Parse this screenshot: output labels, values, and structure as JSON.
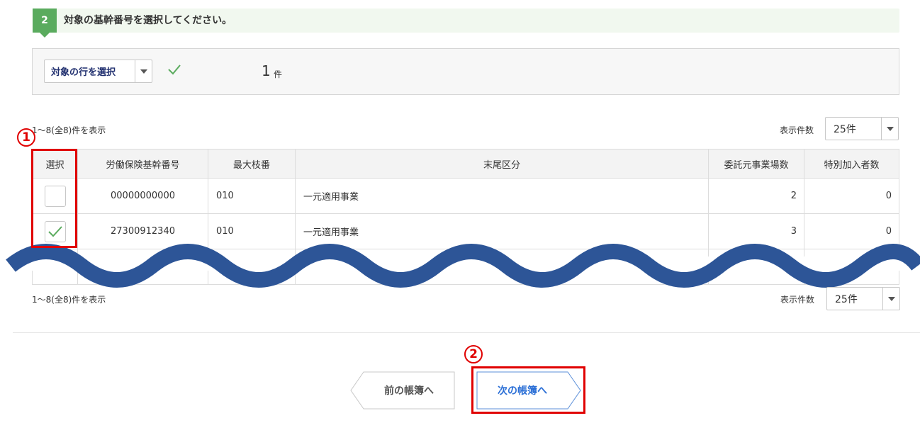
{
  "step": {
    "number": "2",
    "title": "対象の基幹番号を選択してください。"
  },
  "selection": {
    "dropdown_label": "対象の行を選択",
    "count_value": "1",
    "count_unit": "件"
  },
  "pager_top": {
    "range_text": "1～8(全8)件を表示",
    "per_page_label": "表示件数",
    "per_page_value": "25件"
  },
  "pager_bottom": {
    "range_text": "1～8(全8)件を表示",
    "per_page_label": "表示件数",
    "per_page_value": "25件"
  },
  "table": {
    "headers": [
      "選択",
      "労働保険基幹番号",
      "最大枝番",
      "末尾区分",
      "委託元事業場数",
      "特別加入者数"
    ],
    "rows": [
      {
        "checked": false,
        "number": "00000000000",
        "branch": "010",
        "category": "一元適用事業",
        "sites": "2",
        "members": "0"
      },
      {
        "checked": true,
        "number": "27300912340",
        "branch": "010",
        "category": "一元適用事業",
        "sites": "3",
        "members": "0"
      }
    ]
  },
  "annotations": {
    "marker_1": "1",
    "marker_2": "2",
    "color": "#e00000"
  },
  "navigation": {
    "prev_label": "前の帳簿へ",
    "next_label": "次の帳簿へ"
  },
  "colors": {
    "step_accent": "#5aab5e",
    "step_bg": "#f1f8ef",
    "wave": "#2d5597",
    "next_text": "#2b6fd6",
    "check": "#5aab5e"
  }
}
